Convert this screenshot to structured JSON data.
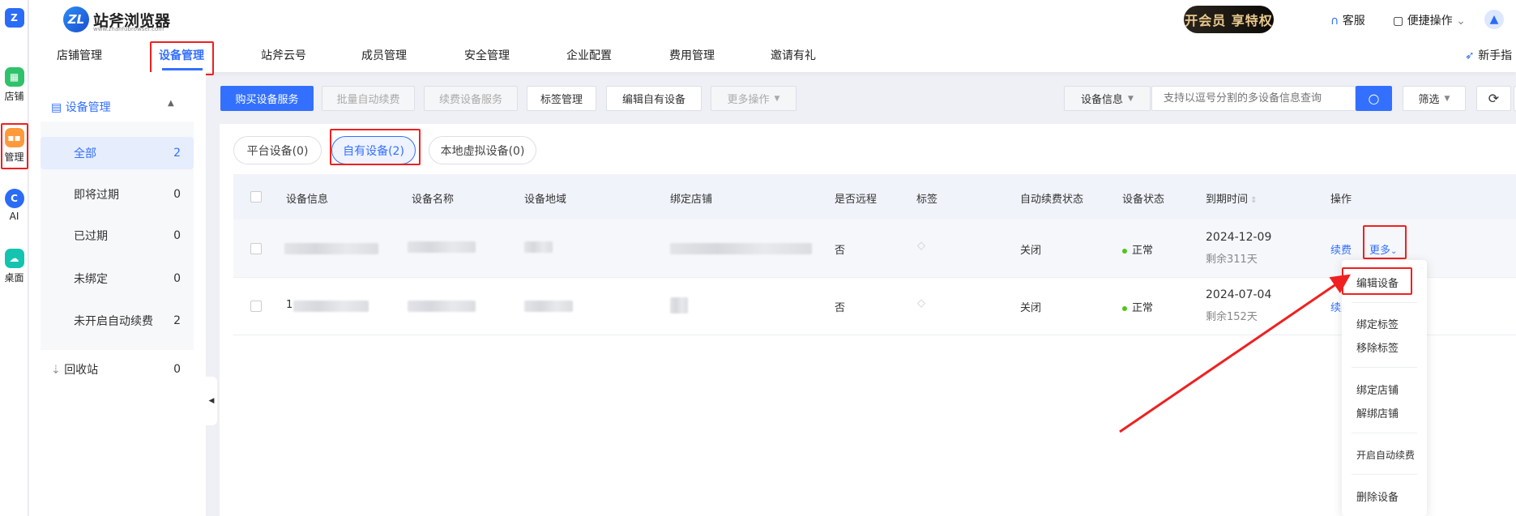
{
  "rail": {
    "items": [
      {
        "label": "",
        "icon": "app-logo-icon"
      },
      {
        "label": "店铺",
        "icon": "store-icon",
        "color": "#2fc26b"
      },
      {
        "label": "管理",
        "icon": "grid-icon",
        "color": "#ff9a3c"
      },
      {
        "label": "AI",
        "icon": "ai-icon",
        "color": "#2a6cf6"
      },
      {
        "label": "桌面",
        "icon": "cloud-desktop-icon",
        "color": "#14c4b0"
      }
    ]
  },
  "header": {
    "logo_text": "站斧浏览器",
    "logo_url": "www.zhanfubrowser.com",
    "vip": "开会员 享特权",
    "support": "客服",
    "quick_ops": "便捷操作",
    "guide": "新手指",
    "nav": [
      "店铺管理",
      "设备管理",
      "站斧云号",
      "成员管理",
      "安全管理",
      "企业配置",
      "费用管理",
      "邀请有礼"
    ],
    "active_nav": "设备管理"
  },
  "sidebar": {
    "title": "设备管理",
    "items": [
      {
        "label": "全部",
        "count": "2"
      },
      {
        "label": "即将过期",
        "count": "0"
      },
      {
        "label": "已过期",
        "count": "0"
      },
      {
        "label": "未绑定",
        "count": "0"
      },
      {
        "label": "未开启自动续费",
        "count": "2"
      }
    ],
    "recycle": {
      "label": "回收站",
      "count": "0"
    }
  },
  "toolbar": {
    "buy": "购买设备服务",
    "batch_renew": "批量自动续费",
    "renew_service": "续费设备服务",
    "tag_manage": "标签管理",
    "edit_own": "编辑自有设备",
    "more": "更多操作",
    "search_field": "设备信息",
    "search_placeholder": "支持以逗号分割的多设备信息查询",
    "filter": "筛选"
  },
  "tabs": [
    "平台设备(0)",
    "自有设备(2)",
    "本地虚拟设备(0)"
  ],
  "table": {
    "columns": [
      "设备信息",
      "设备名称",
      "设备地域",
      "绑定店铺",
      "是否远程",
      "标签",
      "自动续费状态",
      "设备状态",
      "到期时间",
      "操作"
    ],
    "rows": [
      {
        "info": "",
        "remote": "否",
        "auto_renew": "关闭",
        "status": "正常",
        "expire": "2024-12-09",
        "remaining": "剩余311天",
        "renew": "续费",
        "more": "更多"
      },
      {
        "info": "1",
        "remote": "否",
        "auto_renew": "关闭",
        "status": "正常",
        "expire": "2024-07-04",
        "remaining": "剩余152天",
        "renew": "续费"
      }
    ]
  },
  "dropdown": [
    "编辑设备",
    "绑定标签",
    "移除标签",
    "绑定店铺",
    "解绑店铺",
    "开启自动续费",
    "删除设备"
  ],
  "colors": {
    "accent": "#3370ff",
    "annotation": "#f02020",
    "status_ok": "#52c41a"
  }
}
